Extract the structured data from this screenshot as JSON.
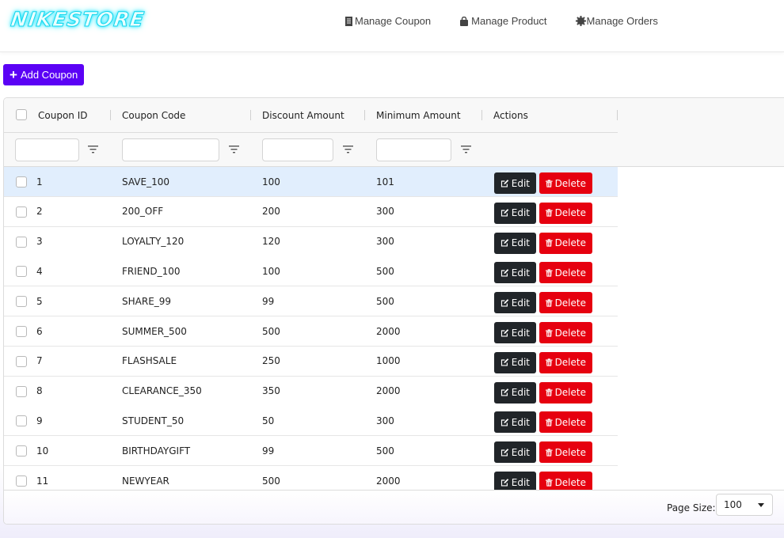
{
  "brand": {
    "logo_text": "NIKESTORE",
    "accent_color": "#5b02f5",
    "logo_glow_color": "#2ee8ff"
  },
  "nav": {
    "items": [
      {
        "label": "Manage Coupon",
        "icon": "receipt-icon"
      },
      {
        "label": "Manage Product",
        "icon": "shopping-bag-icon"
      },
      {
        "label": "Manage Orders",
        "icon": "gear-icon"
      }
    ]
  },
  "toolbar": {
    "add_coupon_label": "Add Coupon",
    "add_icon": "plus-icon"
  },
  "grid": {
    "columns": [
      {
        "key": "id",
        "label": "Coupon ID"
      },
      {
        "key": "code",
        "label": "Coupon Code"
      },
      {
        "key": "discount",
        "label": "Discount Amount"
      },
      {
        "key": "minimum",
        "label": "Minimum Amount"
      },
      {
        "key": "actions",
        "label": "Actions"
      }
    ],
    "filters": {
      "id": "",
      "code": "",
      "discount": "",
      "minimum": ""
    },
    "edit_label": "Edit",
    "delete_label": "Delete",
    "edit_color": "#212529",
    "delete_color": "#e6000f",
    "selected_row_color": "#e1eefd",
    "rows": [
      {
        "id": "1",
        "code": "SAVE_100",
        "discount": "100",
        "minimum": "101",
        "highlighted": true
      },
      {
        "id": "2",
        "code": "200_OFF",
        "discount": "200",
        "minimum": "300"
      },
      {
        "id": "3",
        "code": "LOYALTY_120",
        "discount": "120",
        "minimum": "300"
      },
      {
        "id": "4",
        "code": "FRIEND_100",
        "discount": "100",
        "minimum": "500"
      },
      {
        "id": "5",
        "code": "SHARE_99",
        "discount": "99",
        "minimum": "500"
      },
      {
        "id": "6",
        "code": "SUMMER_500",
        "discount": "500",
        "minimum": "2000"
      },
      {
        "id": "7",
        "code": "FLASHSALE",
        "discount": "250",
        "minimum": "1000"
      },
      {
        "id": "8",
        "code": "CLEARANCE_350",
        "discount": "350",
        "minimum": "2000"
      },
      {
        "id": "9",
        "code": "STUDENT_50",
        "discount": "50",
        "minimum": "300"
      },
      {
        "id": "10",
        "code": "BIRTHDAYGIFT",
        "discount": "99",
        "minimum": "500"
      },
      {
        "id": "11",
        "code": "NEWYEAR",
        "discount": "500",
        "minimum": "2000"
      }
    ],
    "footer": {
      "page_size_label": "Page Size:",
      "page_size_value": "100"
    }
  }
}
